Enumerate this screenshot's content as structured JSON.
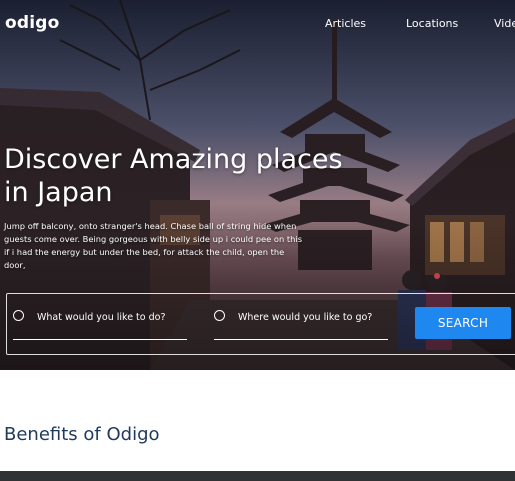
{
  "brand": {
    "logo_text": "odigo"
  },
  "nav": {
    "items": [
      {
        "label": "Articles"
      },
      {
        "label": "Locations"
      },
      {
        "label": "Vide"
      }
    ]
  },
  "hero": {
    "headline": "Discover Amazing places in Japan",
    "tagline": "Jump off balcony, onto stranger's head. Chase ball of string hide when guests come over. Being gorgeous with belly side up i could pee on this if i had the energy but under the bed, for attack the child, open the door,"
  },
  "search": {
    "field1_placeholder": "What would you like to do?",
    "field2_placeholder": "Where would you like to go?",
    "button_label": "SEARCH",
    "button_color": "#1e88f0"
  },
  "benefits": {
    "title": "Benefits of Odigo"
  },
  "colors": {
    "title_color": "#1f3a5a",
    "footer_bar": "#2f3133"
  }
}
